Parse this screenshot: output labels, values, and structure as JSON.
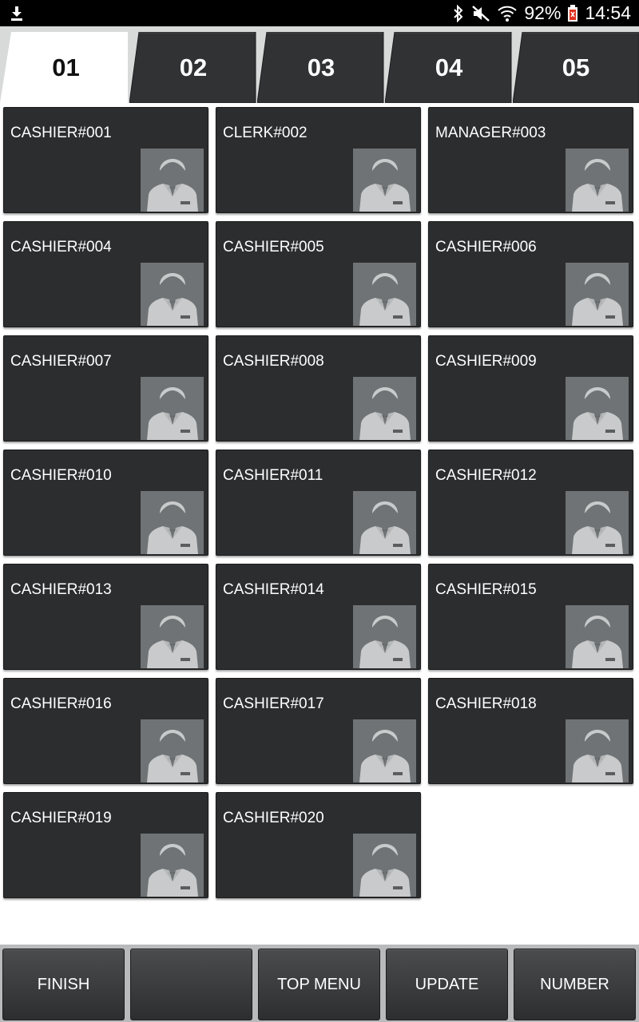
{
  "status_bar": {
    "battery_percent": "92%",
    "time": "14:54",
    "icons": [
      "download-icon",
      "bluetooth-icon",
      "mute-icon",
      "wifi-icon",
      "battery-icon"
    ]
  },
  "tabs": [
    {
      "label": "01",
      "active": true
    },
    {
      "label": "02",
      "active": false
    },
    {
      "label": "03",
      "active": false
    },
    {
      "label": "04",
      "active": false
    },
    {
      "label": "05",
      "active": false
    }
  ],
  "staff": [
    {
      "name": "CASHIER#001"
    },
    {
      "name": "CLERK#002"
    },
    {
      "name": "MANAGER#003"
    },
    {
      "name": "CASHIER#004"
    },
    {
      "name": "CASHIER#005"
    },
    {
      "name": "CASHIER#006"
    },
    {
      "name": "CASHIER#007"
    },
    {
      "name": "CASHIER#008"
    },
    {
      "name": "CASHIER#009"
    },
    {
      "name": "CASHIER#010"
    },
    {
      "name": "CASHIER#011"
    },
    {
      "name": "CASHIER#012"
    },
    {
      "name": "CASHIER#013"
    },
    {
      "name": "CASHIER#014"
    },
    {
      "name": "CASHIER#015"
    },
    {
      "name": "CASHIER#016"
    },
    {
      "name": "CASHIER#017"
    },
    {
      "name": "CASHIER#018"
    },
    {
      "name": "CASHIER#019"
    },
    {
      "name": "CASHIER#020"
    }
  ],
  "bottom_buttons": [
    {
      "label": "FINISH"
    },
    {
      "label": ""
    },
    {
      "label": "TOP MENU"
    },
    {
      "label": "UPDATE"
    },
    {
      "label": "NUMBER"
    }
  ],
  "colors": {
    "card_bg": "#2b2d2e",
    "avatar_bg": "#6f7375",
    "avatar_figure": "#c8cacb",
    "active_tab_bg": "#ffffff",
    "inactive_tab_bg": "#303234"
  }
}
